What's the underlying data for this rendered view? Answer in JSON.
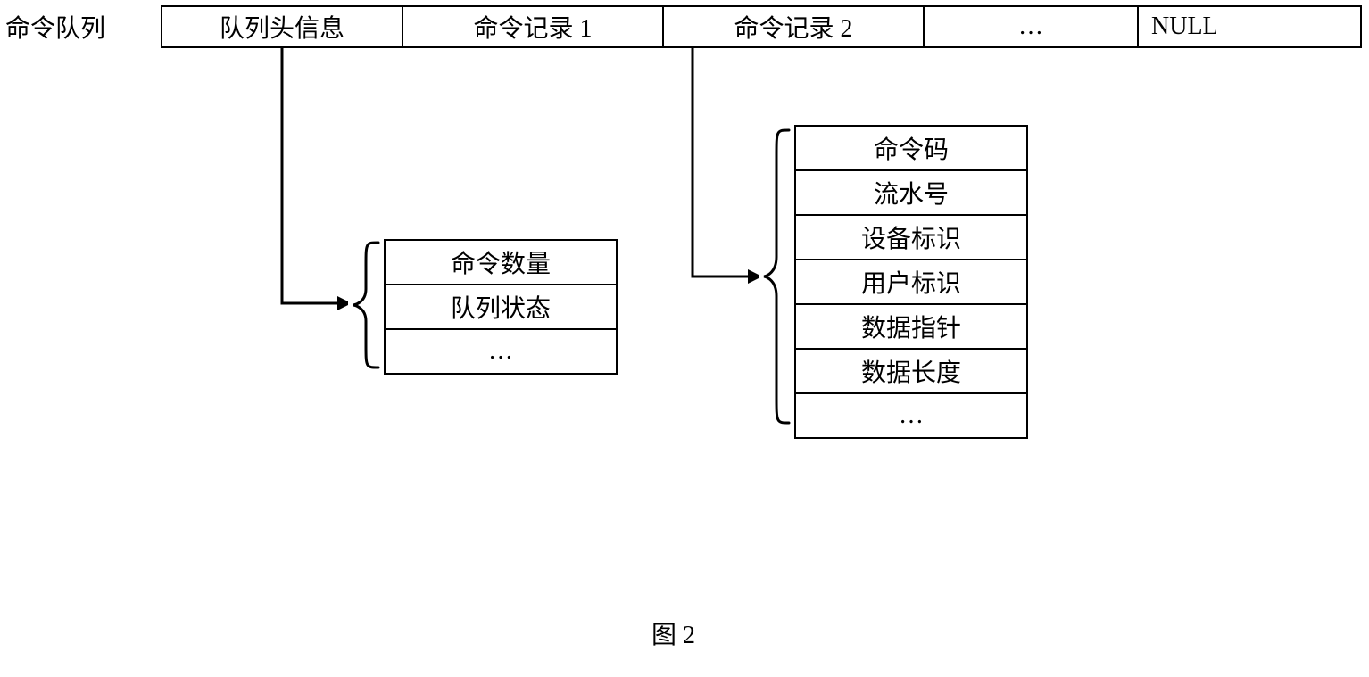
{
  "queue": {
    "label": "命令队列",
    "cells": {
      "header": "队列头信息",
      "record1": "命令记录 1",
      "record2": "命令记录 2",
      "ellipsis": "…",
      "null": "NULL"
    }
  },
  "header_detail": {
    "rows": [
      "命令数量",
      "队列状态",
      "…"
    ]
  },
  "record_detail": {
    "rows": [
      "命令码",
      "流水号",
      "设备标识",
      "用户标识",
      "数据指针",
      "数据长度",
      "…"
    ]
  },
  "caption": "图 2"
}
